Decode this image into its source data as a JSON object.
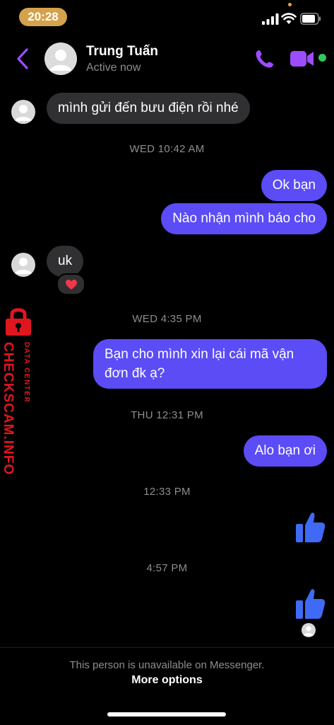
{
  "status_bar": {
    "time": "20:28"
  },
  "header": {
    "name": "Trung Tuấn",
    "status": "Active now"
  },
  "messages": {
    "m1": "mình gửi đến bưu điện rồi nhé",
    "ts1": "WED 10:42 AM",
    "m2": "Ok bạn",
    "m3": "Nào nhận mình báo cho",
    "m4": "uk",
    "m4_reaction": "❤️",
    "ts2": "WED 4:35 PM",
    "m5": "Bạn cho mình xin lại cái mã vận đơn đk ạ?",
    "ts3": "THU 12:31 PM",
    "m6": "Alo bạn ơi",
    "ts4": "12:33 PM",
    "ts5": "4:57 PM"
  },
  "watermark": {
    "main": "CHECKSCAM.INFO",
    "sub": "DATA CENTER"
  },
  "footer": {
    "unavailable": "This person is unavailable on Messenger.",
    "more_options": "More options"
  },
  "colors": {
    "accent": "#5b4cf6",
    "header_icon": "#9b4dff",
    "incoming_bubble": "#303033",
    "like_blue": "#3e6af5",
    "watermark_red": "#e0161e",
    "online": "#31c95a"
  },
  "icons": [
    "back-chevron-icon",
    "phone-icon",
    "video-camera-icon",
    "thumbs-up-icon",
    "heart-icon",
    "lock-icon"
  ]
}
